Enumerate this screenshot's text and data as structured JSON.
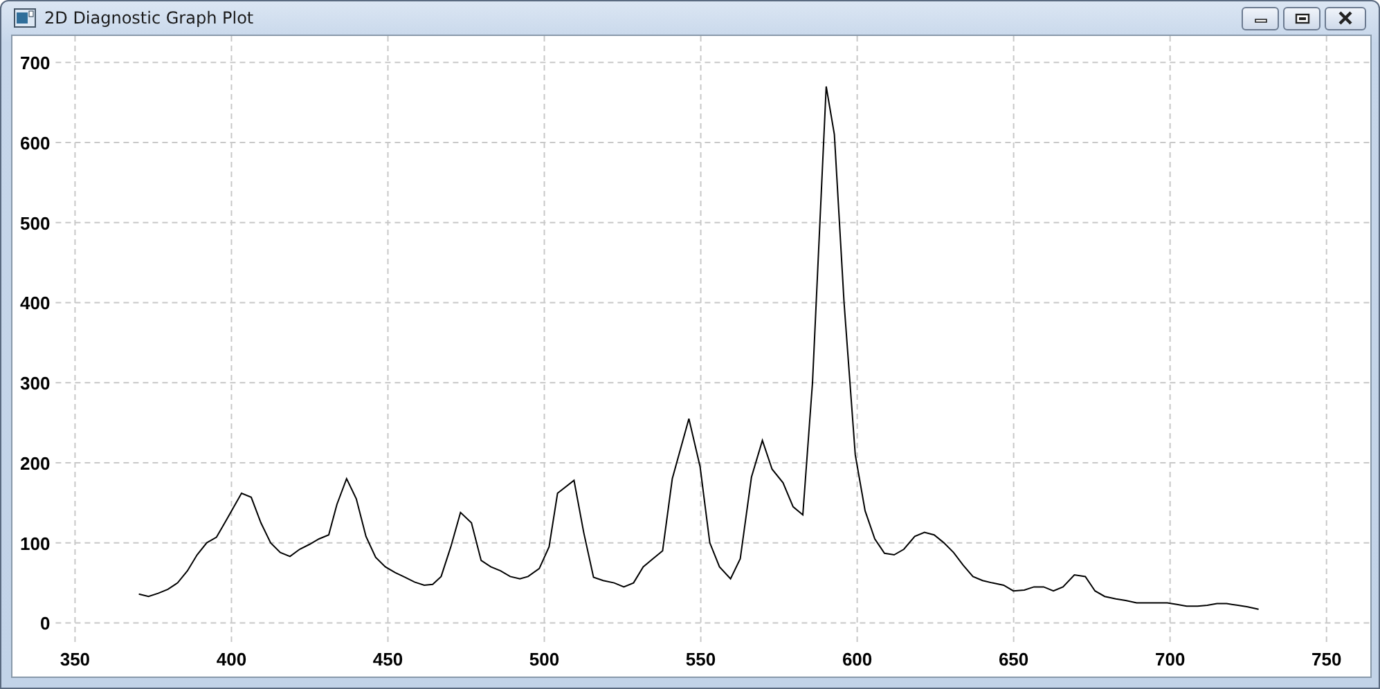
{
  "window": {
    "title": "2D Diagnostic Graph Plot"
  },
  "plot": {
    "chart_data": {
      "type": "line",
      "grid": true,
      "xlim": [
        330,
        764
      ],
      "ylim": [
        -67,
        733
      ],
      "xticks": [
        350,
        400,
        450,
        500,
        550,
        600,
        650,
        700,
        750
      ],
      "yticks": [
        0,
        100,
        200,
        300,
        400,
        500,
        600,
        700
      ],
      "x": [
        370.4,
        373.5,
        376.6,
        379.7,
        382.8,
        385.9,
        389.0,
        392.1,
        395.2,
        398.3,
        403.2,
        406.3,
        409.4,
        412.5,
        415.6,
        418.7,
        421.8,
        424.9,
        428.0,
        431.1,
        433.7,
        436.8,
        439.9,
        443.0,
        446.1,
        449.2,
        452.3,
        455.4,
        458.5,
        461.6,
        464.3,
        467.0,
        470.1,
        473.2,
        476.7,
        479.8,
        482.9,
        486.0,
        489.1,
        492.2,
        494.8,
        498.4,
        501.5,
        504.2,
        509.5,
        512.6,
        515.7,
        518.8,
        522.3,
        525.4,
        528.5,
        531.6,
        534.7,
        537.8,
        540.9,
        546.2,
        549.8,
        552.9,
        556.0,
        559.5,
        562.6,
        566.2,
        569.7,
        572.8,
        576.3,
        579.5,
        582.6,
        585.7,
        590.1,
        592.7,
        595.8,
        599.4,
        602.5,
        605.6,
        608.7,
        611.8,
        614.9,
        618.4,
        621.5,
        624.6,
        627.7,
        630.8,
        633.9,
        637.0,
        640.1,
        643.2,
        646.8,
        649.9,
        653.4,
        656.5,
        659.6,
        662.7,
        665.8,
        669.4,
        672.9,
        676.0,
        679.1,
        682.7,
        685.8,
        689.3,
        692.4,
        695.5,
        699.1,
        702.2,
        705.3,
        708.8,
        711.9,
        715.0,
        718.1,
        721.7,
        724.8,
        728.3
      ],
      "series": [
        {
          "color": "#000000",
          "values": [
            36,
            33,
            37,
            42,
            50,
            65,
            85,
            100,
            107,
            128,
            162,
            157,
            125,
            100,
            88,
            83,
            92,
            98,
            105,
            110,
            148,
            180,
            155,
            108,
            82,
            70,
            63,
            57,
            51,
            47,
            48,
            58,
            95,
            138,
            125,
            78,
            70,
            65,
            58,
            55,
            58,
            68,
            95,
            162,
            178,
            113,
            57,
            53,
            50,
            45,
            50,
            70,
            80,
            90,
            180,
            255,
            195,
            100,
            70,
            55,
            80,
            182,
            228,
            192,
            175,
            145,
            135,
            300,
            670,
            610,
            400,
            210,
            140,
            105,
            87,
            85,
            92,
            108,
            113,
            110,
            100,
            88,
            72,
            58,
            53,
            50,
            47,
            40,
            41,
            45,
            45,
            40,
            45,
            60,
            58,
            40,
            33,
            30,
            28,
            25,
            25,
            25,
            25,
            23,
            21,
            21,
            22,
            24,
            24,
            22,
            20,
            17
          ]
        }
      ]
    }
  }
}
